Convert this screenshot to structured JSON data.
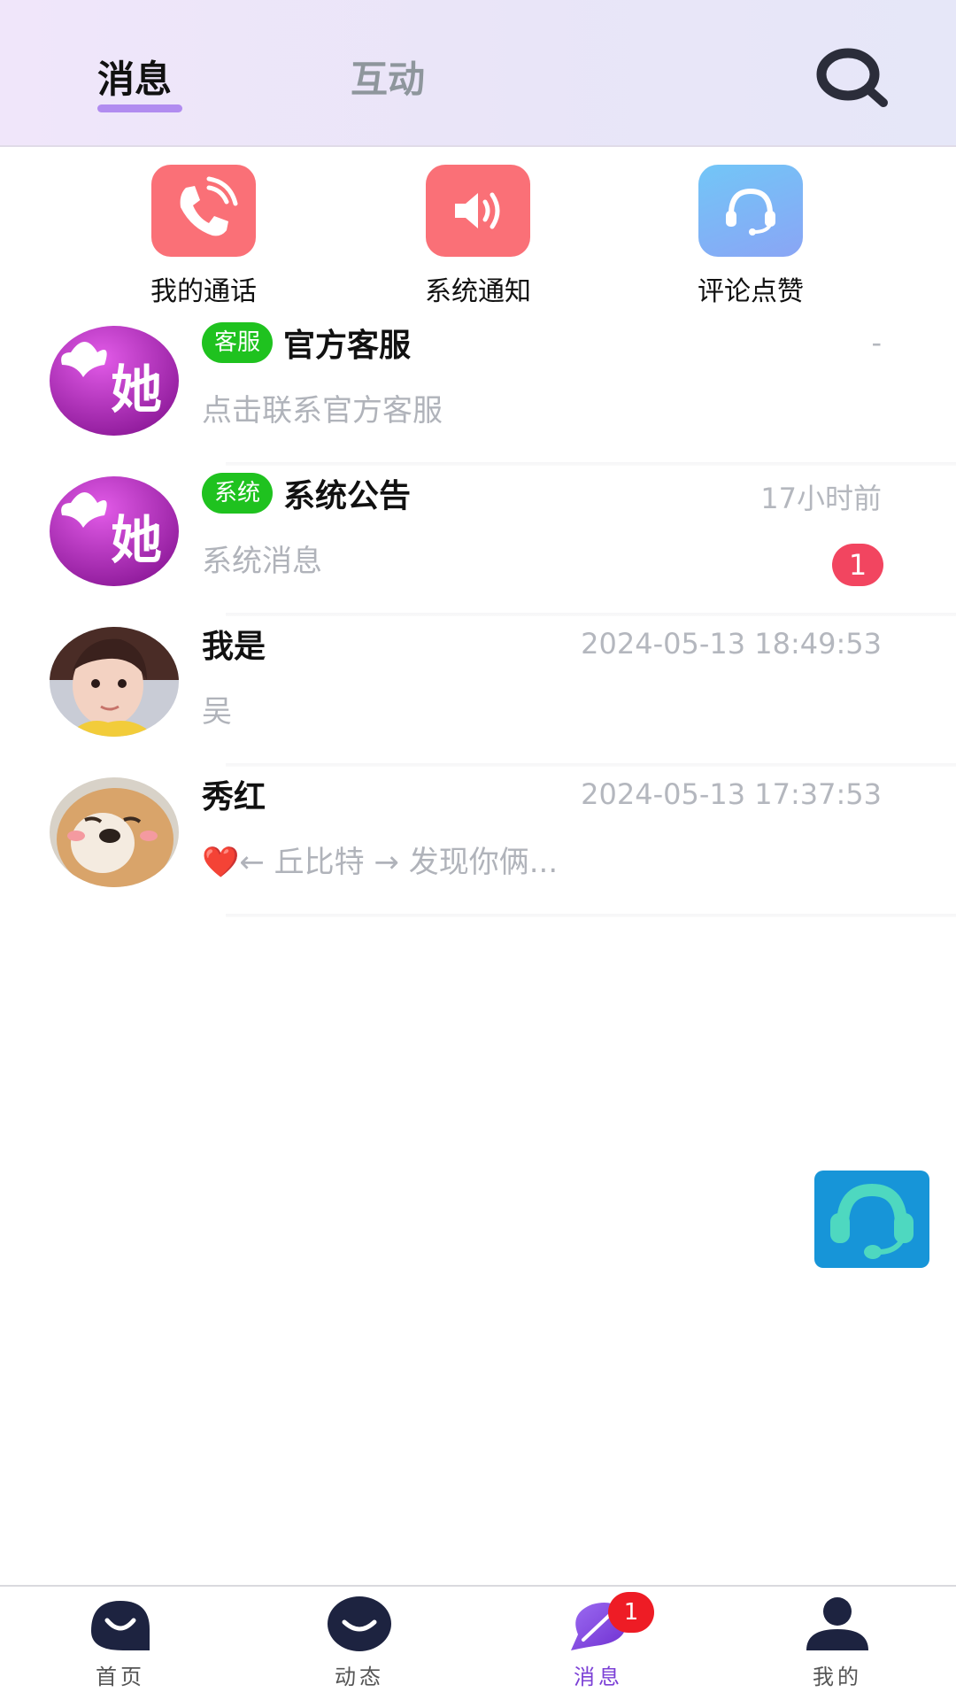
{
  "header": {
    "tabs": [
      {
        "label": "消息",
        "active": true
      },
      {
        "label": "互动",
        "active": false
      }
    ],
    "search_icon": "search-icon"
  },
  "quick_entries": [
    {
      "label": "我的通话",
      "icon": "phone-icon",
      "color": "#fa7077"
    },
    {
      "label": "系统通知",
      "icon": "speaker-icon",
      "color": "#fa7077"
    },
    {
      "label": "评论点赞",
      "icon": "headset-icon",
      "color": "#7ab8f6"
    }
  ],
  "messages": [
    {
      "badge": "客服",
      "name": "官方客服",
      "time": "-",
      "preview": "点击联系官方客服",
      "avatar": "brand-logo"
    },
    {
      "badge": "系统",
      "name": "系统公告",
      "time": "17小时前",
      "preview": "系统消息",
      "unread": "1",
      "avatar": "brand-logo"
    },
    {
      "name": "我是",
      "time": "2024-05-13 18:49:53",
      "preview": "吴",
      "avatar": "user-photo"
    },
    {
      "name": "秀红",
      "time": "2024-05-13 17:37:53",
      "preview": "❤️← 丘比特 → 发现你俩...",
      "avatar": "dog-photo"
    }
  ],
  "brand_logo_text": "她",
  "bottom_nav": {
    "items": [
      {
        "label": "首页",
        "icon": "home-icon",
        "active": false
      },
      {
        "label": "动态",
        "icon": "moments-icon",
        "active": false
      },
      {
        "label": "消息",
        "icon": "message-icon",
        "active": true,
        "badge": "1"
      },
      {
        "label": "我的",
        "icon": "profile-icon",
        "active": false
      }
    ]
  },
  "colors": {
    "accent": "#b18cf0",
    "badge_green": "#1fc21f",
    "unread_red": "#f24560",
    "nav_active": "#7b3fd6"
  }
}
